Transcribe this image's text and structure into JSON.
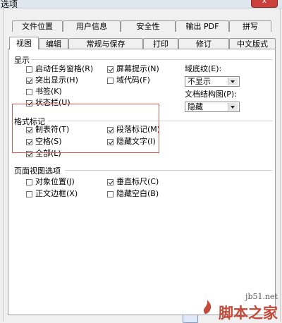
{
  "window": {
    "title": "选项",
    "close_label": "x"
  },
  "tabs_row1": [
    {
      "label": "文件位置"
    },
    {
      "label": "用户信息"
    },
    {
      "label": "安全性"
    },
    {
      "label": "输出 PDF"
    },
    {
      "label": "拼写"
    }
  ],
  "tabs_row2": [
    {
      "label": "视图",
      "active": true
    },
    {
      "label": "编辑"
    },
    {
      "label": "常规与保存"
    },
    {
      "label": "打印"
    },
    {
      "label": "修订"
    },
    {
      "label": "中文版式"
    }
  ],
  "display": {
    "title": "显示",
    "options": [
      {
        "label": "启动任务窗格(R)",
        "checked": false
      },
      {
        "label": "突出显示(H)",
        "checked": true
      },
      {
        "label": "书签(K)",
        "checked": false
      },
      {
        "label": "状态栏(U)",
        "checked": true
      },
      {
        "label": "屏幕提示(N)",
        "checked": true
      },
      {
        "label": "域代码(F)",
        "checked": false
      }
    ],
    "field_shading": {
      "label": "域底纹(E):",
      "value": "不显示"
    },
    "doc_map": {
      "label": "文档结构图(P):",
      "value": "隐藏"
    }
  },
  "format_marks": {
    "title": "格式标记",
    "options": [
      {
        "label": "制表符(T)",
        "checked": true
      },
      {
        "label": "空格(S)",
        "checked": true
      },
      {
        "label": "全部(L)",
        "checked": true
      },
      {
        "label": "段落标记(M)",
        "checked": true
      },
      {
        "label": "隐藏文字(I)",
        "checked": true
      }
    ]
  },
  "page_view": {
    "title": "页面视图选项",
    "options": [
      {
        "label": "对象位置(J)",
        "checked": false
      },
      {
        "label": "正文边框(X)",
        "checked": false
      },
      {
        "label": "垂直标尺(C)",
        "checked": true
      },
      {
        "label": "隐藏空白(B)",
        "checked": false
      }
    ]
  },
  "watermark": {
    "site": "jb51.net",
    "brand": "脚本之家"
  },
  "colors": {
    "highlight": "#d9534f",
    "brand": "#c44a3a"
  }
}
